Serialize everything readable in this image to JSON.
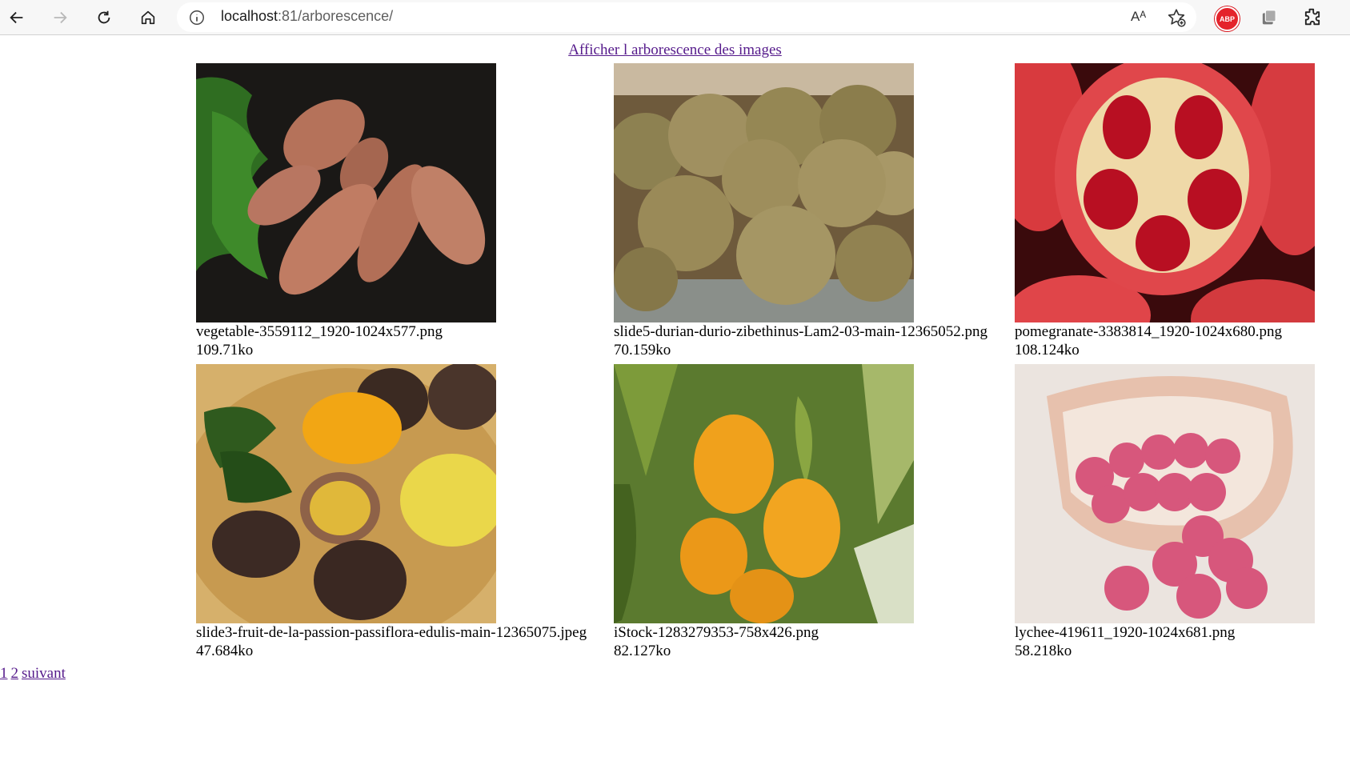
{
  "browser": {
    "url_host": "localhost",
    "url_path": ":81/arborescence/",
    "read_aloud": "Aᴬ"
  },
  "page": {
    "top_link": "Afficher l arborescence des images",
    "images": [
      {
        "name": "vegetable-3559112_1920-1024x577.png",
        "size": "109.71ko"
      },
      {
        "name": "slide5-durian-durio-zibethinus-Lam2-03-main-12365052.png",
        "size": "70.159ko"
      },
      {
        "name": "pomegranate-3383814_1920-1024x680.png",
        "size": "108.124ko"
      },
      {
        "name": "slide3-fruit-de-la-passion-passiflora-edulis-main-12365075.jpeg",
        "size": "47.684ko"
      },
      {
        "name": "iStock-1283279353-758x426.png",
        "size": "82.127ko"
      },
      {
        "name": "lychee-419611_1920-1024x681.png",
        "size": "58.218ko"
      }
    ],
    "pagination": {
      "page1": "1",
      "page2": "2",
      "next": "suivant"
    }
  },
  "icons": [
    "back-icon",
    "forward-icon",
    "reload-icon",
    "home-icon",
    "info-icon",
    "read-aloud-icon",
    "favorite-add-icon",
    "adblock-icon",
    "collections-icon",
    "extensions-icon"
  ]
}
